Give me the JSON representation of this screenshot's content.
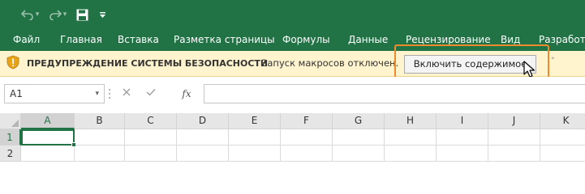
{
  "colors": {
    "brand": "#217346",
    "warning_bar": "#fff4ce",
    "highlight_border": "#ef8a2f"
  },
  "quick_access": {
    "undo_icon": "undo-icon",
    "redo_icon": "redo-icon",
    "save_icon": "save-icon",
    "customize_icon": "customize-qat-icon"
  },
  "ribbon": {
    "tabs": [
      "Файл",
      "Главная",
      "Вставка",
      "Разметка страницы",
      "Формулы",
      "Данные",
      "Рецензирование",
      "Вид",
      "Разработч"
    ]
  },
  "security_bar": {
    "icon": "shield-icon",
    "title": "ПРЕДУПРЕЖДЕНИЕ СИСТЕМЫ БЕЗОПАСНОСТИ",
    "message": "Запуск макросов отключен.",
    "button_label": "Включить содержимое"
  },
  "formula_bar": {
    "name_box_value": "A1",
    "cancel_icon": "cancel-icon",
    "confirm_icon": "check-icon",
    "function_icon": "fx-icon",
    "fx_label": "fx",
    "formula_value": ""
  },
  "grid": {
    "columns": [
      "A",
      "B",
      "C",
      "D",
      "E",
      "F",
      "G",
      "H",
      "I",
      "J",
      "K"
    ],
    "rows": [
      "1",
      "2"
    ],
    "selected_cell": "A1"
  }
}
